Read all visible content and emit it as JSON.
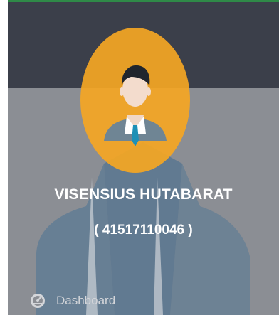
{
  "profile": {
    "name": "VISENSIUS HUTABARAT",
    "id": "( 41517110046 )",
    "avatar_icon": "user-avatar-icon"
  },
  "menu": {
    "items": [
      {
        "label": "Dashboard",
        "icon": "dashboard-icon"
      }
    ]
  },
  "colors": {
    "accent_top": "#2f8a48",
    "header_bg": "#3b3f4a",
    "sidebar_bg": "#8b8e94",
    "avatar_bg": "#f5a623"
  }
}
